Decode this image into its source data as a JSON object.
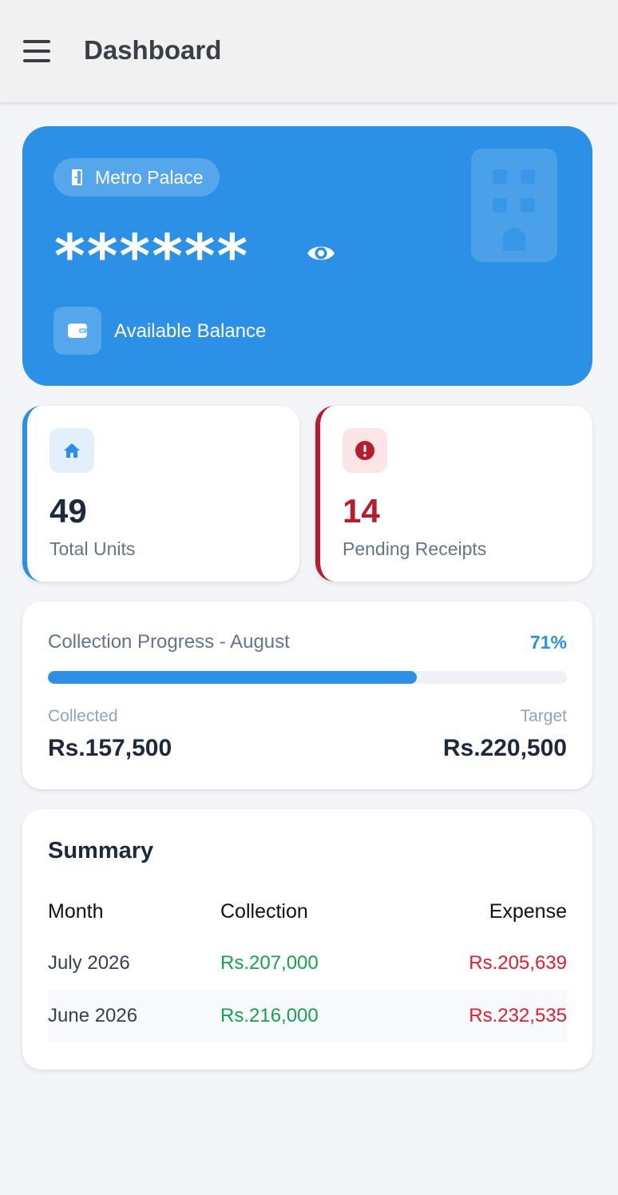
{
  "header": {
    "title": "Dashboard",
    "menu_icon": "hamburger-menu-icon"
  },
  "balance_card": {
    "property_name": "Metro Palace",
    "masked_balance": "******",
    "balance_label": "Available Balance",
    "background_color": "#2b90e6"
  },
  "stats": {
    "total_units": {
      "value": "49",
      "label": "Total Units",
      "icon": "home-icon",
      "accent": "#2b90e6"
    },
    "pending_receipts": {
      "value": "14",
      "label": "Pending Receipts",
      "icon": "alert-circle-icon",
      "accent": "#b91c2c"
    }
  },
  "progress": {
    "title": "Collection Progress - August",
    "percent_label": "71%",
    "percent_value": 71,
    "collected_label": "Collected",
    "collected_value": "Rs.157,500",
    "target_label": "Target",
    "target_value": "Rs.220,500"
  },
  "summary": {
    "title": "Summary",
    "columns": [
      "Month",
      "Collection",
      "Expense"
    ],
    "rows": [
      {
        "month": "July 2026",
        "collection": "Rs.207,000",
        "expense": "Rs.205,639"
      },
      {
        "month": "June 2026",
        "collection": "Rs.216,000",
        "expense": "Rs.232,535"
      }
    ],
    "collection_color": "#16a34a",
    "expense_color": "#e11d2e"
  }
}
